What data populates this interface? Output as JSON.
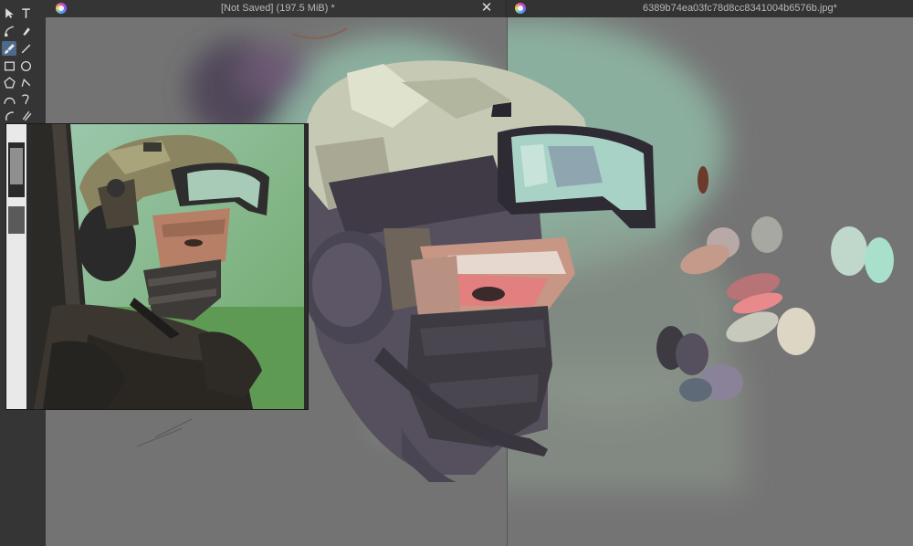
{
  "app": {
    "accent": "#4d6a8a"
  },
  "tabs": [
    {
      "title": "[Not Saved]  (197.5 MiB) *",
      "close_glyph": "✕"
    },
    {
      "title": "6389b74ea03fc78d8cc8341004b6576b.jpg*"
    }
  ],
  "toolbox": {
    "tools": [
      "select-arrow-icon",
      "text-tool-icon",
      "edit-shapes-icon",
      "calligraphy-pen-icon",
      "brush-tool-icon",
      "line-tool-icon",
      "rectangle-tool-icon",
      "ellipse-tool-icon",
      "polygon-tool-icon",
      "polyline-tool-icon",
      "bezier-tool-icon",
      "freehand-path-icon",
      "dynamic-brush-icon",
      "multibrush-icon"
    ],
    "active_tool": "brush-tool-icon"
  },
  "colors": {
    "palette_swatches": [
      "#6b3a2a",
      "#b9a9a6",
      "#a8a8a2",
      "#c49a8a",
      "#c0d8cc",
      "#a9e0cc",
      "#b77376",
      "#e88a8c",
      "#c6c9bc",
      "#ddd6c4",
      "#3e3a42",
      "#56505e",
      "#8a8298",
      "#5f6a78"
    ]
  }
}
